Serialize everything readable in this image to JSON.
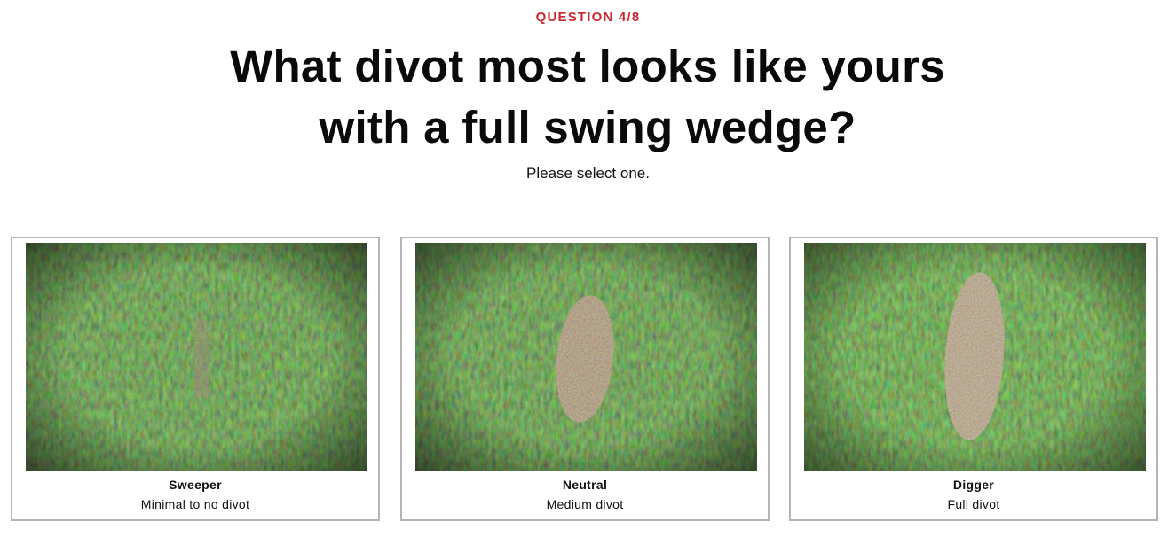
{
  "quiz": {
    "progress": "QUESTION 4/8",
    "question_line1": "What divot most looks like yours",
    "question_line2": "with a full swing wedge?",
    "instruction": "Please select one."
  },
  "options": [
    {
      "title": "Sweeper",
      "description": "Minimal to no divot"
    },
    {
      "title": "Neutral",
      "description": "Medium divot"
    },
    {
      "title": "Digger",
      "description": "Full divot"
    }
  ],
  "colors": {
    "accent": "#c8282d",
    "card_border": "#b4b4b4",
    "grass": "#3f6b2a",
    "soil": "#6b5a45"
  }
}
